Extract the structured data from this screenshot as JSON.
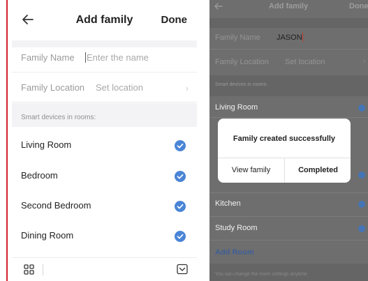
{
  "left": {
    "header": {
      "title": "Add family",
      "done_label": "Done"
    },
    "family_name": {
      "label": "Family Name",
      "placeholder": "Enter the name"
    },
    "family_location": {
      "label": "Family Location",
      "value": "Set location"
    },
    "section_label": "Smart devices in rooms:",
    "rooms": [
      {
        "name": "Living Room",
        "checked": true
      },
      {
        "name": "Bedroom",
        "checked": true
      },
      {
        "name": "Second Bedroom",
        "checked": true
      },
      {
        "name": "Dining Room",
        "checked": true
      }
    ],
    "accent_color": "#4a85d6"
  },
  "right": {
    "header": {
      "title": "Add family",
      "done_label": "Done"
    },
    "family_name": {
      "label": "Family Name",
      "value": "JASON"
    },
    "family_location": {
      "label": "Family Location",
      "value": "Set location"
    },
    "section_label": "Smart devices in rooms:",
    "rooms": [
      {
        "name": "Living Room"
      },
      {
        "name": "Kitchen"
      },
      {
        "name": "Study Room"
      }
    ],
    "add_room_label": "Add Room",
    "footer_note": "You can change the room settings anytime",
    "dialog": {
      "message": "Family created successfully",
      "view_label": "View family",
      "complete_label": "Completed"
    }
  }
}
